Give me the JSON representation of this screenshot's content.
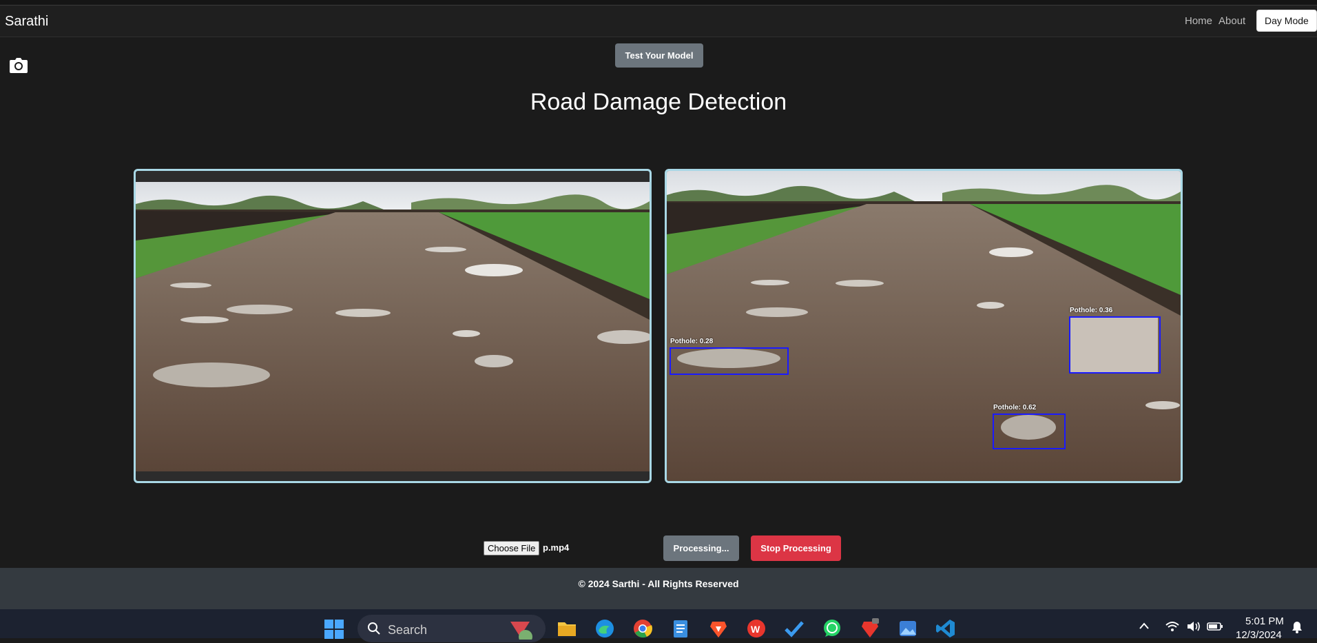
{
  "navbar": {
    "brand": "Sarathi",
    "home": "Home",
    "about": "About",
    "day_mode": "Day Mode"
  },
  "test_button": "Test Your Model",
  "page_title": "Road Damage Detection",
  "detections": [
    {
      "label": "Pothole: 0.28"
    },
    {
      "label": "Pothole: 0.36"
    },
    {
      "label": "Pothole: 0.62"
    }
  ],
  "controls": {
    "choose_file": "Choose File",
    "file_name": "p.mp4",
    "processing": "Processing...",
    "stop": "Stop Processing"
  },
  "footer": "© 2024 Sarthi - All Rights Reserved",
  "taskbar": {
    "search_placeholder": "Search",
    "apps": [
      "start-icon",
      "file-explorer-icon",
      "edge-icon",
      "chrome-icon",
      "notepad-icon",
      "brave-icon",
      "wps-icon",
      "todo-icon",
      "whatsapp-icon",
      "brave-beta-icon",
      "photos-icon",
      "vscode-icon"
    ],
    "time": "5:01 PM",
    "date": "12/3/2024"
  },
  "colors": {
    "accent_border": "#a9d8e6",
    "stop": "#dc3545",
    "secondary": "#6c757d",
    "detection_box": "#1a1aff"
  }
}
